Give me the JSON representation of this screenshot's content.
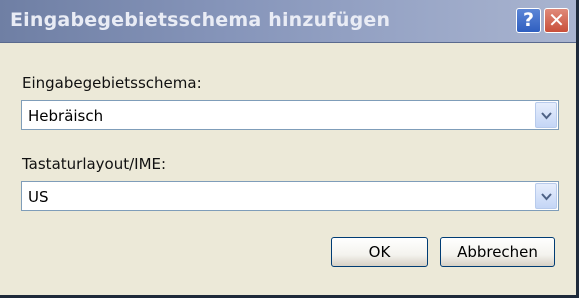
{
  "window": {
    "title": "Eingabegebietsschema hinzufügen",
    "help_glyph": "?",
    "close_glyph": "✕"
  },
  "input_locale": {
    "label": "Eingabegebietsschema:",
    "value": "Hebräisch"
  },
  "keyboard_layout": {
    "label": "Tastaturlayout/IME:",
    "value": "US"
  },
  "buttons": {
    "ok": "OK",
    "cancel": "Abbrechen"
  },
  "colors": {
    "titlebar": "#8695ba",
    "dialog_face": "#ece9d8",
    "combo_border": "#7f9db9",
    "button_border": "#003c74"
  },
  "icons": {
    "help": "help-icon",
    "close": "close-icon",
    "dropdown": "chevron-down-icon"
  }
}
